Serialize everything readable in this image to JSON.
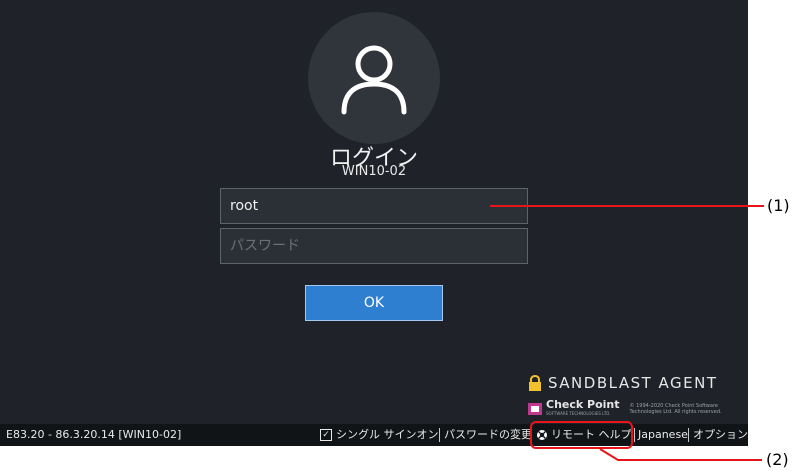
{
  "login": {
    "title": "ログイン",
    "machine": "WIN10-02",
    "username_value": "root",
    "password_placeholder": "パスワード",
    "ok_label": "OK"
  },
  "branding": {
    "product": "SANDBLAST AGENT",
    "vendor": "Check Point",
    "vendor_tagline": "SOFTWARE TECHNOLOGIES LTD.",
    "copyright": "© 1994-2020 Check Point Software Technologies Ltd. All rights reserved."
  },
  "statusbar": {
    "version": "E83.20 - 86.3.20.14 [WIN10-02]",
    "single_signon": "シングル サインオン",
    "password_change": "パスワードの変更",
    "remote_help": "リモート ヘルプ",
    "language": "Japanese",
    "options": "オプション"
  },
  "callouts": {
    "one": "(1)",
    "two": "(2)"
  },
  "colors": {
    "background": "#1f2329",
    "ok_button": "#2f7fd0",
    "highlight": "#e8141b"
  }
}
